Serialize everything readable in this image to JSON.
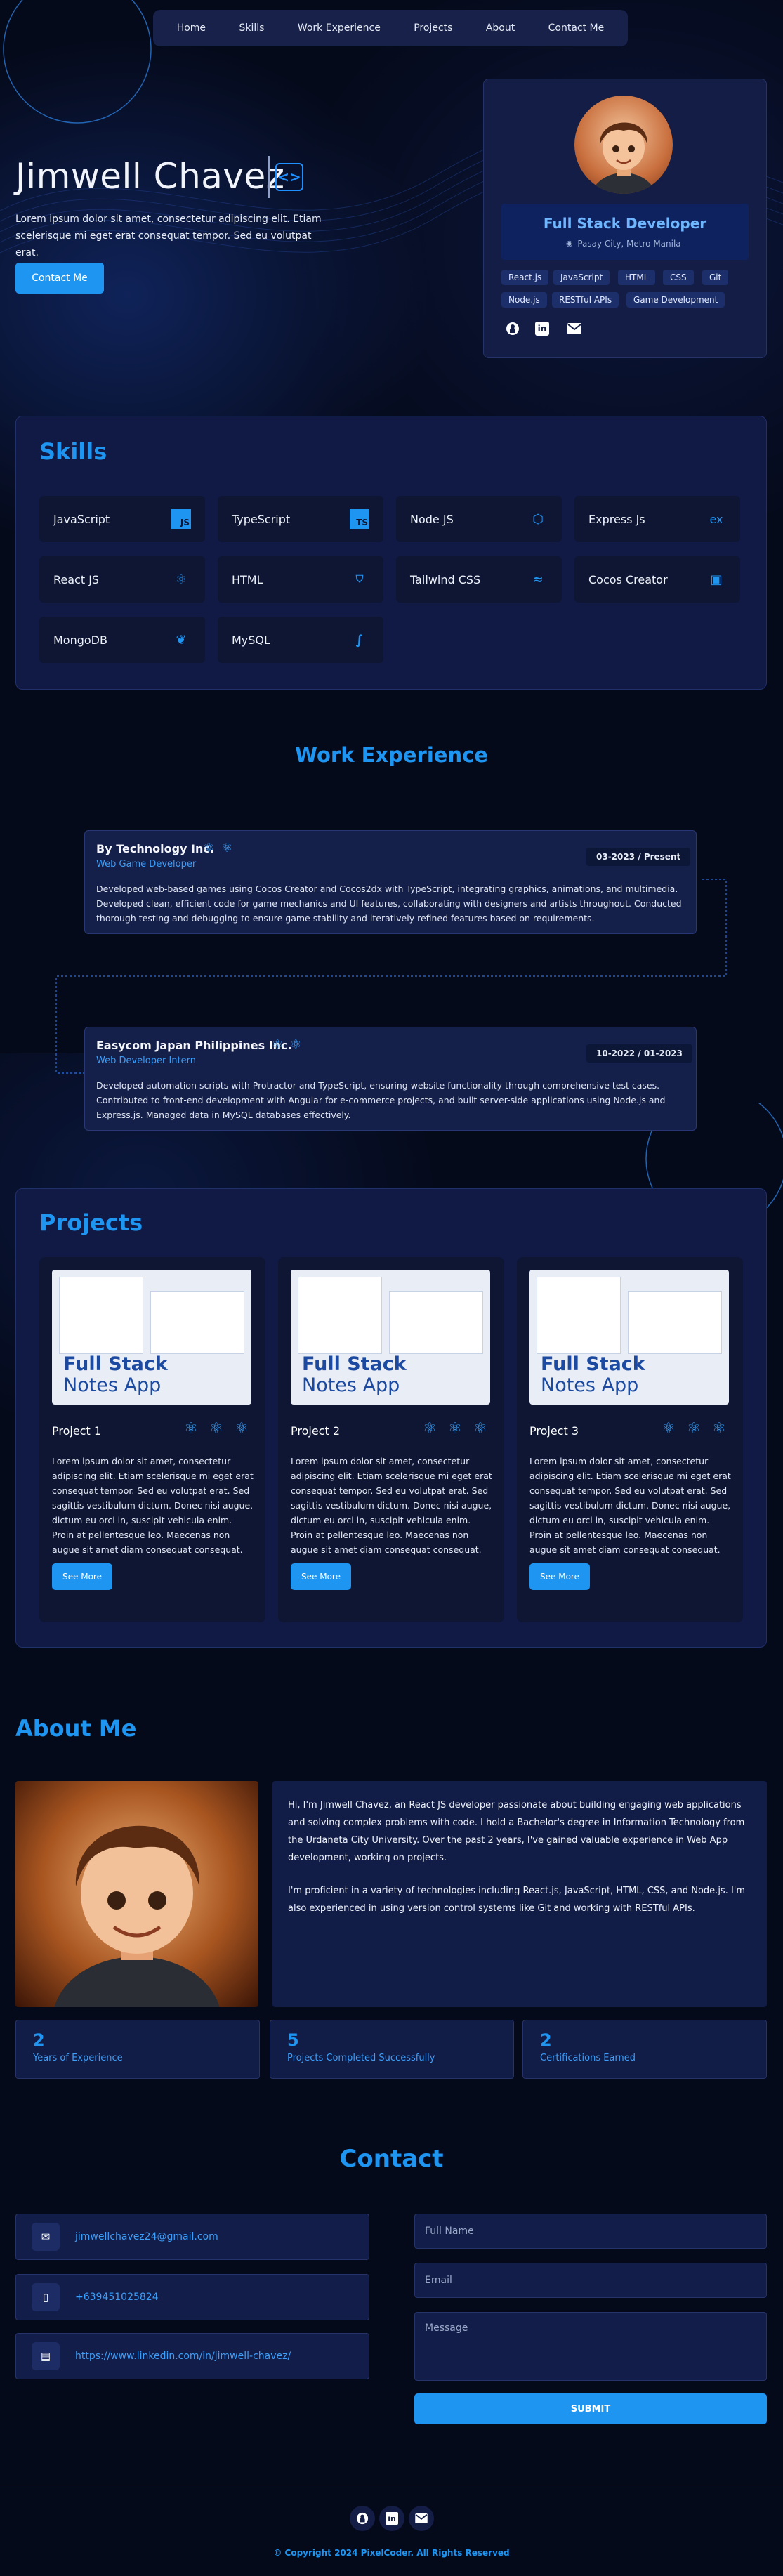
{
  "nav": {
    "items": [
      "Home",
      "Skills",
      "Work Experience",
      "Projects",
      "About",
      "Contact Me"
    ]
  },
  "hero": {
    "name": "Jimwell Chavez",
    "description": "Lorem ipsum dolor sit amet, consectetur adipiscing elit. Etiam scelerisque mi eget erat consequat tempor. Sed eu volutpat erat.",
    "cta": "Contact Me"
  },
  "profile": {
    "title": "Full Stack Developer",
    "location": "Pasay City, Metro Manila",
    "tags": [
      "React.js",
      "JavaScript",
      "HTML",
      "CSS",
      "Git",
      "Node.js",
      "RESTful APIs",
      "Game Development"
    ]
  },
  "skills": {
    "title": "Skills",
    "items": [
      "JavaScript",
      "TypeScript",
      "Node JS",
      "Express Js",
      "React JS",
      "HTML",
      "Tailwind CSS",
      "Cocos Creator",
      "MongoDB",
      "MySQL"
    ]
  },
  "work": {
    "title": "Work Experience",
    "jobs": [
      {
        "company": "By Technology Inc.",
        "role": "Web Game Developer",
        "date": "03-2023 / Present",
        "desc": "Developed web-based games using Cocos Creator and Cocos2dx with TypeScript, integrating graphics, animations, and multimedia. Developed clean, efficient code for game mechanics and UI features, collaborating with designers and artists throughout. Conducted thorough testing and debugging to ensure game stability and iteratively refined features based on requirements."
      },
      {
        "company": "Easycom Japan Philippines Inc.",
        "role": "Web Developer Intern",
        "date": "10-2022 / 01-2023",
        "desc": "Developed automation scripts with Protractor and TypeScript, ensuring website functionality through comprehensive test cases. Contributed to front-end development with Angular for e-commerce projects, and built server-side applications using Node.js and Express.js. Managed data in MySQL databases effectively."
      }
    ]
  },
  "projects": {
    "title": "Projects",
    "shot_text": [
      "Full Stack",
      "Notes App"
    ],
    "items": [
      {
        "name": "Project 1",
        "desc": "Lorem ipsum dolor sit amet, consectetur adipiscing elit. Etiam scelerisque mi eget erat consequat tempor. Sed eu volutpat erat. Sed sagittis vestibulum dictum. Donec nisi augue, dictum eu orci in, suscipit vehicula enim. Proin at pellentesque leo. Maecenas non augue sit amet diam consequat consequat.",
        "button": "See More"
      },
      {
        "name": "Project 2",
        "desc": "Lorem ipsum dolor sit amet, consectetur adipiscing elit. Etiam scelerisque mi eget erat consequat tempor. Sed eu volutpat erat. Sed sagittis vestibulum dictum. Donec nisi augue, dictum eu orci in, suscipit vehicula enim. Proin at pellentesque leo. Maecenas non augue sit amet diam consequat consequat.",
        "button": "See More"
      },
      {
        "name": "Project 3",
        "desc": "Lorem ipsum dolor sit amet, consectetur adipiscing elit. Etiam scelerisque mi eget erat consequat tempor. Sed eu volutpat erat. Sed sagittis vestibulum dictum. Donec nisi augue, dictum eu orci in, suscipit vehicula enim. Proin at pellentesque leo. Maecenas non augue sit amet diam consequat consequat.",
        "button": "See More"
      }
    ]
  },
  "about": {
    "title": "About Me",
    "p1": "Hi, I'm Jimwell Chavez, an React JS developer passionate about building engaging web applications and solving complex problems with code. I hold a Bachelor's degree in Information Technology from the Urdaneta City University. Over the past 2 years, I've gained valuable experience in Web App development, working on projects.",
    "p2": "I'm proficient in a variety of technologies including React.js, JavaScript, HTML, CSS, and Node.js. I'm also experienced in using version control systems like Git and working with RESTful APIs.",
    "stats": [
      {
        "n": "2",
        "t": "Years of Experience"
      },
      {
        "n": "5",
        "t": "Projects Completed Successfully"
      },
      {
        "n": "2",
        "t": "Certifications Earned"
      }
    ]
  },
  "contact": {
    "title": "Contact",
    "email": "jimwellchavez24@gmail.com",
    "phone": "+639451025824",
    "linkedin": "https://www.linkedin.com/in/jimwell-chavez/",
    "name_ph": "Full Name",
    "email_ph": "Email",
    "message_ph": "Message",
    "submit": "SUBMIT"
  },
  "footer": {
    "copyright": "© Copyright 2024 PixelCoder. All Rights Reserved"
  }
}
